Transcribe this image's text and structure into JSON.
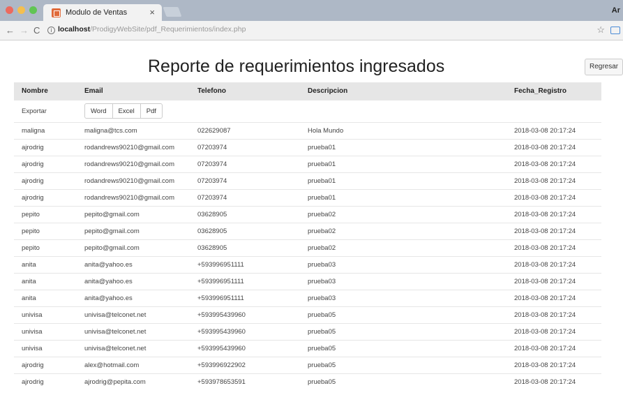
{
  "browser": {
    "tab_title": "Modulo de Ventas",
    "tab_close": "×",
    "user_initial": "Ar",
    "url_host": "localhost",
    "url_path": "/ProdigyWebSite/pdf_Requerimientos/index.php"
  },
  "page": {
    "title": "Reporte de requerimientos ingresados",
    "back_label": "Regresar"
  },
  "table": {
    "headers": [
      "Nombre",
      "Email",
      "Telefono",
      "Descripcion",
      "Fecha_Registro"
    ],
    "export_label": "Exportar",
    "export_buttons": [
      "Word",
      "Excel",
      "Pdf"
    ],
    "rows": [
      [
        "maligna",
        "maligna@tcs.com",
        "022629087",
        "Hola Mundo",
        "2018-03-08 20:17:24"
      ],
      [
        "ajrodrig",
        "rodandrews90210@gmail.com",
        "07203974",
        "prueba01",
        "2018-03-08 20:17:24"
      ],
      [
        "ajrodrig",
        "rodandrews90210@gmail.com",
        "07203974",
        "prueba01",
        "2018-03-08 20:17:24"
      ],
      [
        "ajrodrig",
        "rodandrews90210@gmail.com",
        "07203974",
        "prueba01",
        "2018-03-08 20:17:24"
      ],
      [
        "ajrodrig",
        "rodandrews90210@gmail.com",
        "07203974",
        "prueba01",
        "2018-03-08 20:17:24"
      ],
      [
        "pepito",
        "pepito@gmail.com",
        "03628905",
        "prueba02",
        "2018-03-08 20:17:24"
      ],
      [
        "pepito",
        "pepito@gmail.com",
        "03628905",
        "prueba02",
        "2018-03-08 20:17:24"
      ],
      [
        "pepito",
        "pepito@gmail.com",
        "03628905",
        "prueba02",
        "2018-03-08 20:17:24"
      ],
      [
        "anita",
        "anita@yahoo.es",
        "+593996951111",
        "prueba03",
        "2018-03-08 20:17:24"
      ],
      [
        "anita",
        "anita@yahoo.es",
        "+593996951111",
        "prueba03",
        "2018-03-08 20:17:24"
      ],
      [
        "anita",
        "anita@yahoo.es",
        "+593996951111",
        "prueba03",
        "2018-03-08 20:17:24"
      ],
      [
        "univisa",
        "univisa@telconet.net",
        "+593995439960",
        "prueba05",
        "2018-03-08 20:17:24"
      ],
      [
        "univisa",
        "univisa@telconet.net",
        "+593995439960",
        "prueba05",
        "2018-03-08 20:17:24"
      ],
      [
        "univisa",
        "univisa@telconet.net",
        "+593995439960",
        "prueba05",
        "2018-03-08 20:17:24"
      ],
      [
        "ajrodrig",
        "alex@hotmail.com",
        "+593996922902",
        "prueba05",
        "2018-03-08 20:17:24"
      ],
      [
        "ajrodrig",
        "ajrodrig@pepita.com",
        "+593978653591",
        "prueba05",
        "2018-03-08 20:17:24"
      ]
    ]
  }
}
